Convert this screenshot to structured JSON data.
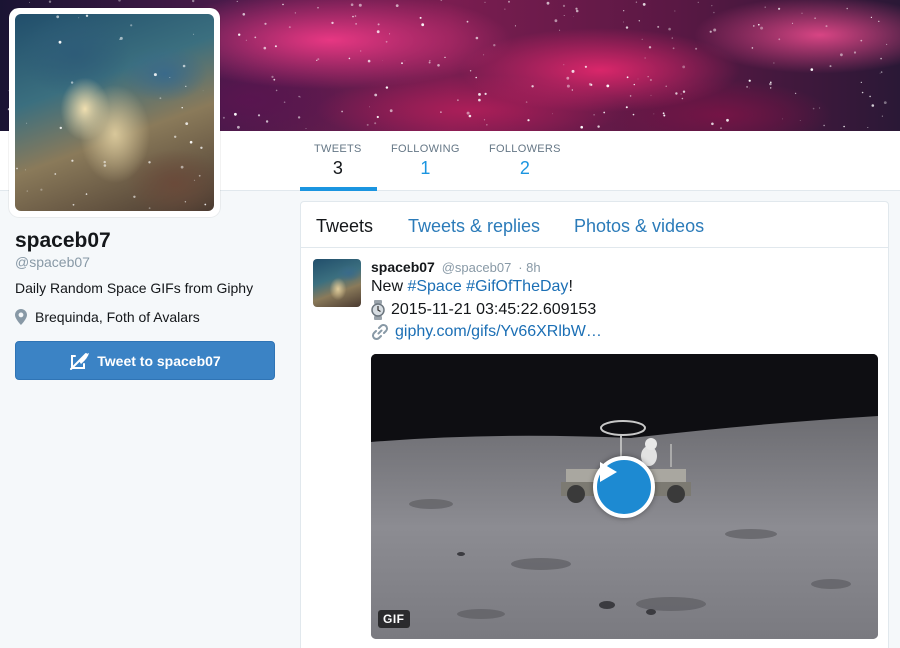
{
  "profile": {
    "name": "spaceb07",
    "handle": "@spaceb07",
    "bio": "Daily Random Space GIFs from Giphy",
    "location": "Brequinda, Foth of Avalars",
    "tweet_to_label": "Tweet to spaceb07"
  },
  "stats": [
    {
      "label": "TWEETS",
      "value": "3"
    },
    {
      "label": "FOLLOWING",
      "value": "1"
    },
    {
      "label": "FOLLOWERS",
      "value": "2"
    }
  ],
  "tabs": [
    {
      "label": "Tweets"
    },
    {
      "label": "Tweets & replies"
    },
    {
      "label": "Photos & videos"
    }
  ],
  "tweet": {
    "name": "spaceb07",
    "handle": "@spaceb07",
    "time": "· 8h",
    "text_prefix": "New ",
    "hashtag_1": "#Space",
    "hashtag_2": "#GifOfTheDay",
    "text_suffix": "!",
    "timestamp": "2015-11-21 03:45:22.609153",
    "link": "giphy.com/gifs/Yv66XRlbW…",
    "media_badge": "GIF"
  },
  "colors": {
    "accent": "#1b95e0",
    "button": "#3b83c5",
    "link": "#1b6fb5"
  }
}
